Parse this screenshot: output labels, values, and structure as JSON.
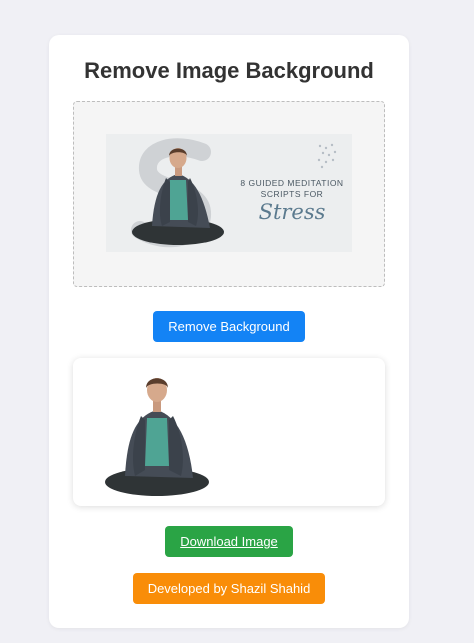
{
  "page": {
    "title": "Remove Image Background"
  },
  "upload_preview": {
    "heading_text": "8 GUIDED MEDITATION SCRIPTS FOR",
    "script_text": "Stress"
  },
  "actions": {
    "remove_label": "Remove Background",
    "download_label": "Download Image",
    "developer_label": "Developed by Shazil Shahid"
  },
  "colors": {
    "page_bg": "#f0f0f5",
    "remove_button": "#1383f5",
    "download_button": "#2aa445",
    "developer_button": "#f98d08"
  }
}
